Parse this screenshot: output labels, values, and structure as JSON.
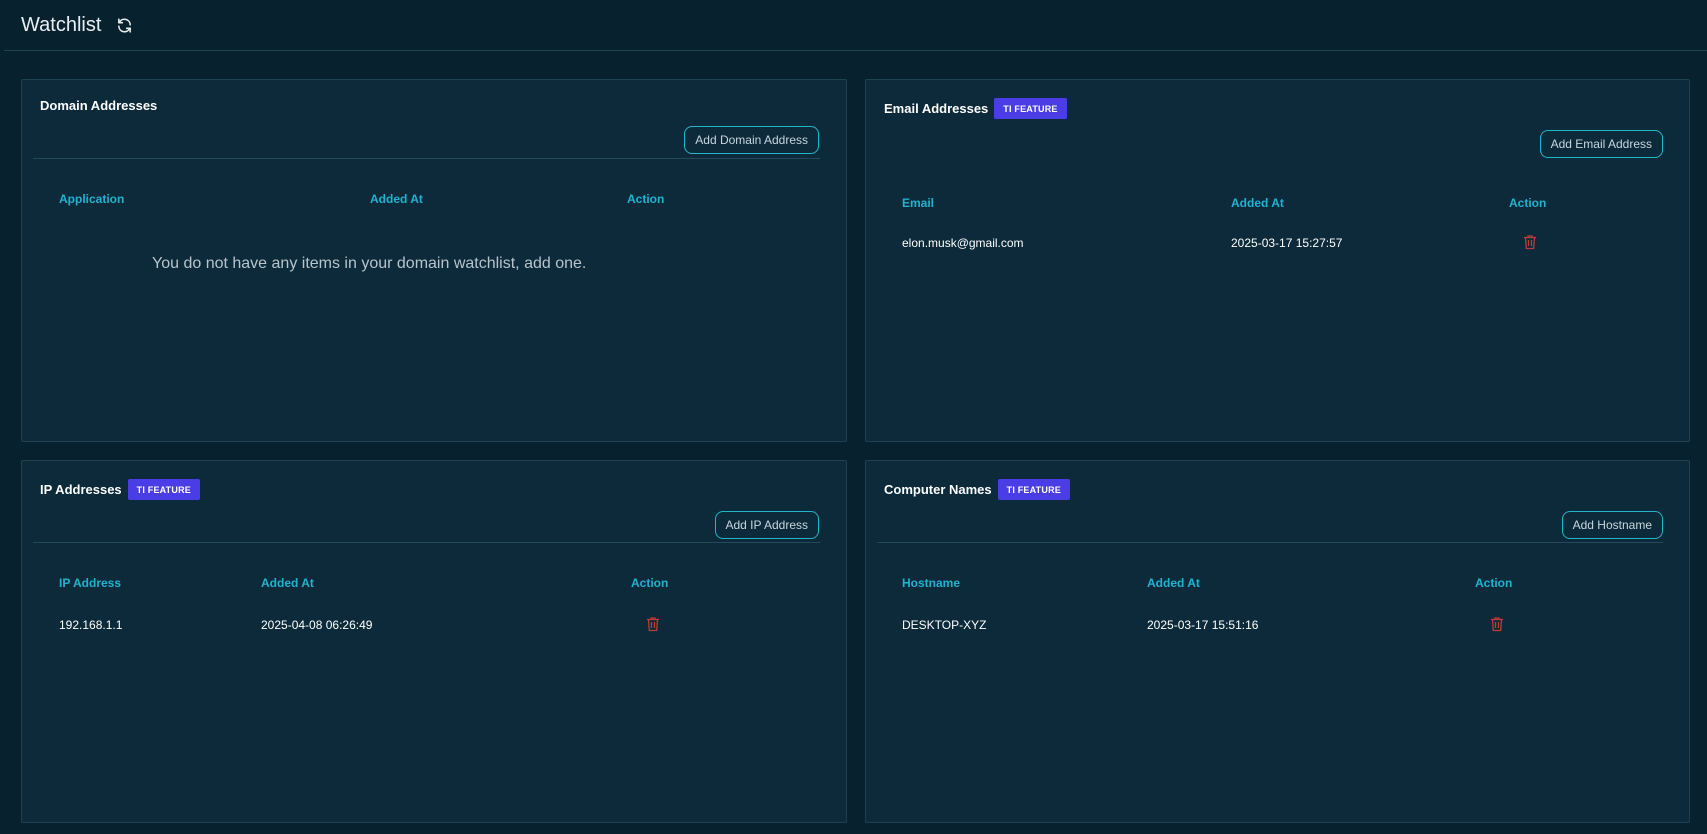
{
  "header": {
    "title": "Watchlist",
    "refresh_icon": "refresh-icon"
  },
  "domain": {
    "title": "Domain Addresses",
    "add_label": "Add Domain Address",
    "columns": [
      "Application",
      "Added At",
      "Action"
    ],
    "empty_message": "You do not have any items in your domain watchlist, add one."
  },
  "email": {
    "title": "Email Addresses",
    "badge": "TI FEATURE",
    "add_label": "Add Email Address",
    "columns": [
      "Email",
      "Added At",
      "Action"
    ],
    "rows": [
      {
        "value": "elon.musk@gmail.com",
        "added_at": "2025-03-17 15:27:57",
        "action_icon": "trash-icon"
      }
    ]
  },
  "ip": {
    "title": "IP Addresses",
    "badge": "TI FEATURE",
    "add_label": "Add IP Address",
    "columns": [
      "IP Address",
      "Added At",
      "Action"
    ],
    "rows": [
      {
        "value": "192.168.1.1",
        "added_at": "2025-04-08 06:26:49",
        "action_icon": "trash-icon"
      }
    ]
  },
  "host": {
    "title": "Computer Names",
    "badge": "TI FEATURE",
    "add_label": "Add Hostname",
    "columns": [
      "Hostname",
      "Added At",
      "Action"
    ],
    "rows": [
      {
        "value": "DESKTOP-XYZ",
        "added_at": "2025-03-17 15:51:16",
        "action_icon": "trash-icon"
      }
    ]
  },
  "colors": {
    "background": "#07212f",
    "card": "#0c2a3a",
    "accent": "#1fb3d0",
    "badge": "#4b3de6",
    "danger": "#c0393b"
  }
}
